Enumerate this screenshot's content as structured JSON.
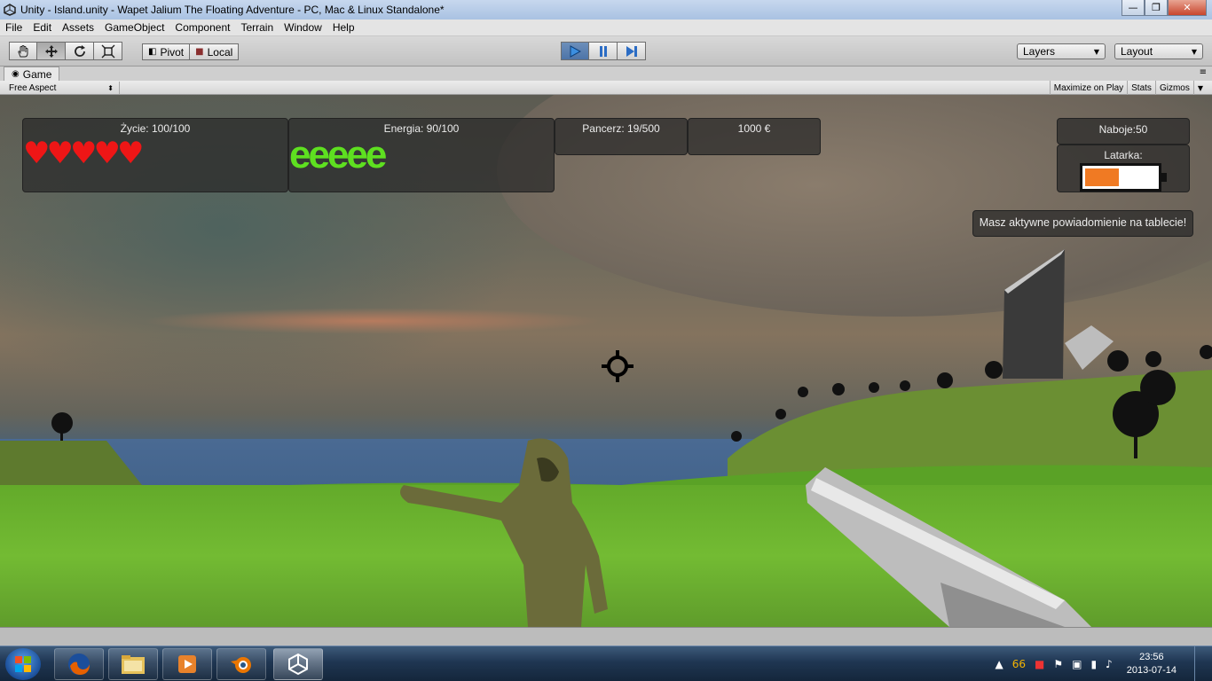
{
  "window": {
    "title": "Unity - Island.unity - Wapet Jalium The Floating Adventure - PC, Mac & Linux Standalone*",
    "controls": {
      "minimize": "—",
      "maximize": "❐",
      "close": "✕"
    }
  },
  "menu": [
    "File",
    "Edit",
    "Assets",
    "GameObject",
    "Component",
    "Terrain",
    "Window",
    "Help"
  ],
  "toolbar": {
    "tools": [
      "hand-tool",
      "move-tool",
      "rotate-tool",
      "scale-tool"
    ],
    "pivot_label": "Pivot",
    "local_label": "Local",
    "playback": [
      "play",
      "pause",
      "step"
    ],
    "layers_label": "Layers",
    "layout_label": "Layout"
  },
  "game_view": {
    "tab_label": "Game",
    "aspect": "Free Aspect",
    "maximize_on_play": "Maximize on Play",
    "stats": "Stats",
    "gizmos": "Gizmos"
  },
  "hud": {
    "health_label": "Życie: 100/100",
    "health_hearts": 5,
    "energy_label": "Energia: 90/100",
    "energy_glyphs": "eeeee",
    "armor_label": "Pancerz: 19/500",
    "money_label": "1000 €",
    "ammo_label": "Naboje:50",
    "flashlight_label": "Latarka:",
    "flashlight_level": 0.5,
    "notification": "Masz aktywne powiadomienie na tablecie!"
  },
  "taskbar": {
    "apps": [
      "firefox",
      "explorer",
      "media-player",
      "blender",
      "unity"
    ],
    "tray_count": "66",
    "time": "23:56",
    "date": "2013-07-14"
  },
  "colors": {
    "heart": "#ee1616",
    "energy": "#5ee020",
    "battery_fill": "#f07a23",
    "play_active": "#4d74a8"
  }
}
